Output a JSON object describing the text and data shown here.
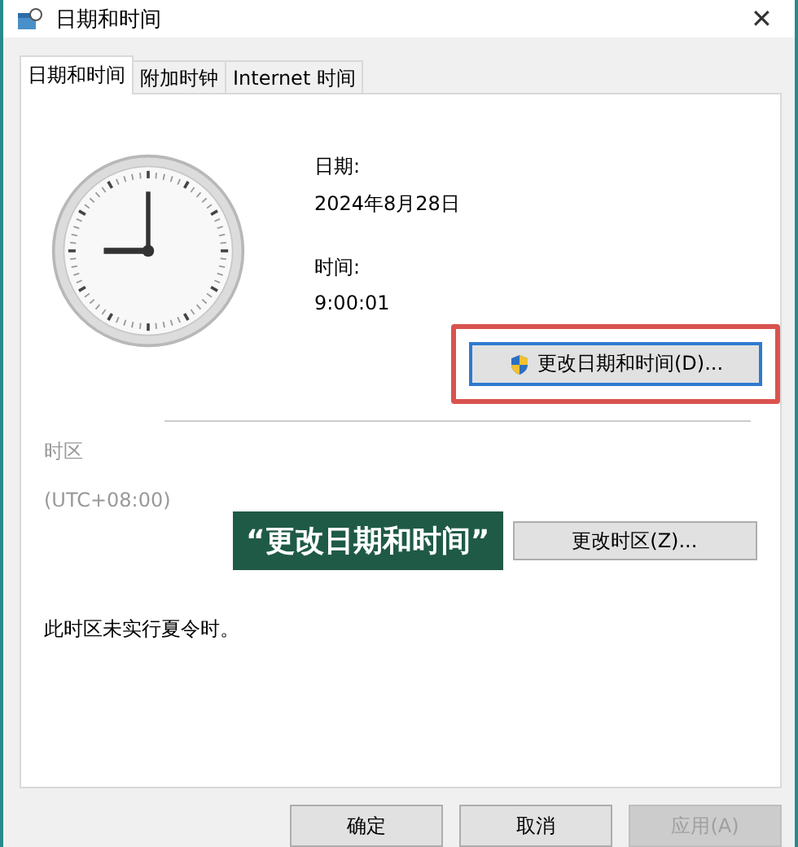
{
  "window": {
    "title": "日期和时间",
    "close": "✕"
  },
  "tabs": [
    {
      "label": "日期和时间",
      "selected": true
    },
    {
      "label": "附加时钟",
      "selected": false
    },
    {
      "label": "Internet 时间",
      "selected": false
    }
  ],
  "date": {
    "label": "日期:",
    "value": "2024年8月28日"
  },
  "time": {
    "label": "时间:",
    "value": "9:00:01"
  },
  "change_datetime_button": {
    "label": "更改日期和时间(D)...",
    "highlighted": true
  },
  "timezone": {
    "label": "时区",
    "value": "(UTC+08:00)",
    "button": "更改时区(Z)..."
  },
  "caption": "“更改日期和时间”",
  "dst_note": "此时区未实行夏令时。",
  "buttons": [
    {
      "label": "确定",
      "disabled": false
    },
    {
      "label": "取消",
      "disabled": false
    },
    {
      "label": "应用(A)",
      "disabled": true
    }
  ]
}
